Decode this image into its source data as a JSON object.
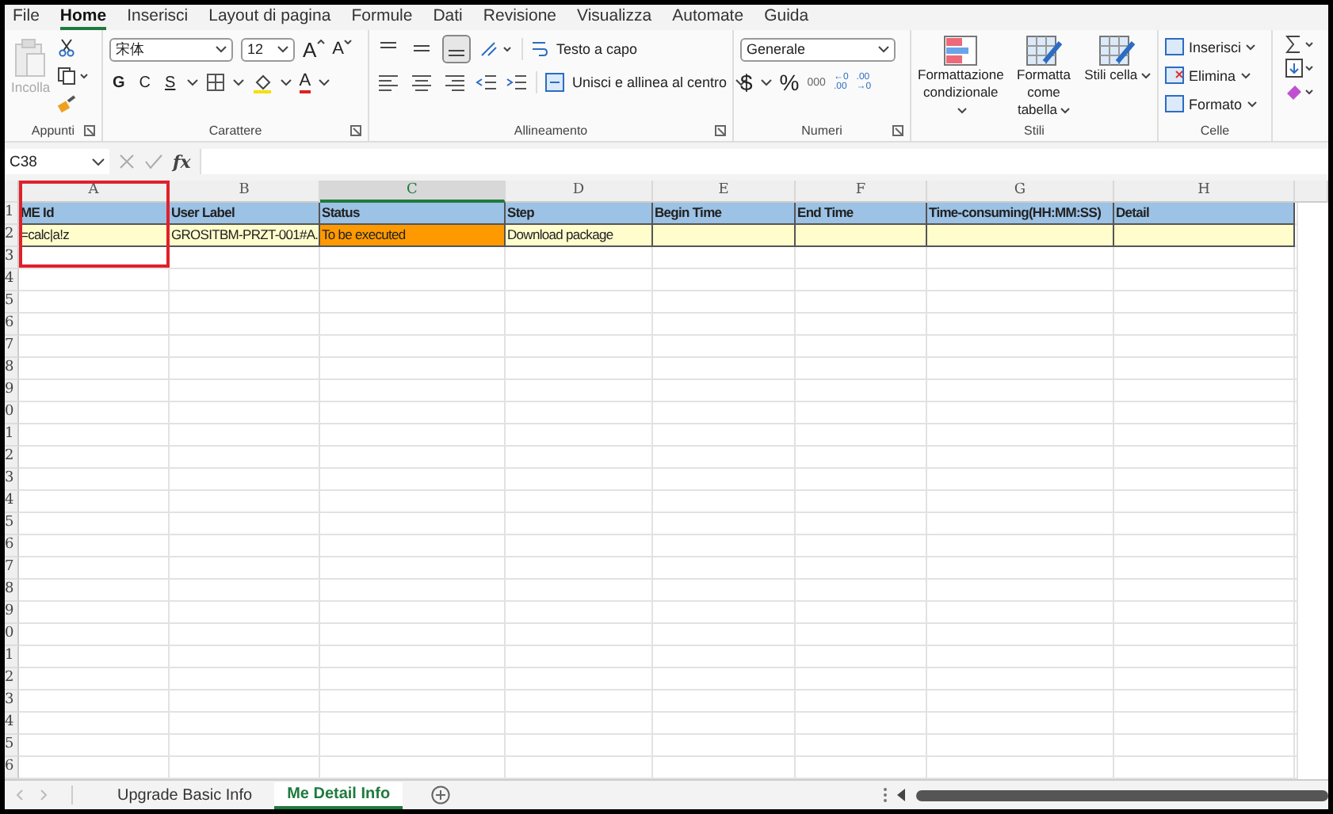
{
  "menu_tabs": [
    {
      "label": "File",
      "selected": false
    },
    {
      "label": "Home",
      "selected": true
    },
    {
      "label": "Inserisci",
      "selected": false
    },
    {
      "label": "Layout di pagina",
      "selected": false
    },
    {
      "label": "Formule",
      "selected": false
    },
    {
      "label": "Dati",
      "selected": false
    },
    {
      "label": "Revisione",
      "selected": false
    },
    {
      "label": "Visualizza",
      "selected": false
    },
    {
      "label": "Automate",
      "selected": false
    },
    {
      "label": "Guida",
      "selected": false
    }
  ],
  "ribbon": {
    "appunti": {
      "title": "Appunti",
      "paste": {
        "label": "Incolla",
        "disabled": true
      }
    },
    "carattere": {
      "title": "Carattere",
      "font": "宋体",
      "size": "12",
      "grow": "A",
      "shrink": "A",
      "bold": "G",
      "italic": "C",
      "underline": "S",
      "font_color": "A"
    },
    "allineamento": {
      "title": "Allineamento",
      "wrap": "Testo a capo",
      "merge": "Unisci e allinea al centro"
    },
    "numeri": {
      "title": "Numeri",
      "format": "Generale",
      "currency": "$",
      "percent": "%",
      "thousands": "000",
      "increase": "←0\n.00",
      "decrease": ".00\n→0"
    },
    "stili": {
      "title": "Stili",
      "buttons": [
        "Formattazione condizionale",
        "Formatta come tabella",
        "Stili cella"
      ]
    },
    "celle": {
      "title": "Celle",
      "buttons": [
        "Inserisci",
        "Elimina",
        "Formato"
      ]
    }
  },
  "formula_bar": {
    "name_box": "C38",
    "function_symbol": "fx"
  },
  "columns": [
    {
      "letter": "A",
      "selected": false
    },
    {
      "letter": "B",
      "selected": false
    },
    {
      "letter": "C",
      "selected": true
    },
    {
      "letter": "D",
      "selected": false
    },
    {
      "letter": "E",
      "selected": false
    },
    {
      "letter": "F",
      "selected": false
    },
    {
      "letter": "G",
      "selected": false
    },
    {
      "letter": "H",
      "selected": false
    }
  ],
  "rows": [
    {
      "number": "1",
      "kind": "header",
      "cells": [
        {
          "text": "ME Id",
          "highlight": false
        },
        {
          "text": "User Label",
          "highlight": false
        },
        {
          "text": "Status",
          "highlight": false
        },
        {
          "text": "Step",
          "highlight": false
        },
        {
          "text": "Begin Time",
          "highlight": false
        },
        {
          "text": "End Time",
          "highlight": false
        },
        {
          "text": "Time-consuming(HH:MM:SS)",
          "highlight": false
        },
        {
          "text": "Detail",
          "highlight": false
        }
      ]
    },
    {
      "number": "2",
      "kind": "data",
      "cells": [
        {
          "text": "=calc|a!z",
          "highlight": false
        },
        {
          "text": "GROSITBM-PRZT-001#A.",
          "highlight": false
        },
        {
          "text": "To be executed",
          "highlight": true
        },
        {
          "text": "Download package",
          "highlight": false
        },
        {
          "text": "",
          "highlight": false
        },
        {
          "text": "",
          "highlight": false
        },
        {
          "text": "",
          "highlight": false
        },
        {
          "text": "",
          "highlight": false
        }
      ]
    },
    {
      "number": "3",
      "kind": "blank"
    },
    {
      "number": "4",
      "kind": "blank"
    },
    {
      "number": "5",
      "kind": "blank"
    },
    {
      "number": "6",
      "kind": "blank"
    },
    {
      "number": "7",
      "kind": "blank"
    },
    {
      "number": "8",
      "kind": "blank"
    },
    {
      "number": "9",
      "kind": "blank"
    },
    {
      "number": "0",
      "kind": "blank"
    },
    {
      "number": "1",
      "kind": "blank"
    },
    {
      "number": "2",
      "kind": "blank"
    },
    {
      "number": "3",
      "kind": "blank"
    },
    {
      "number": "4",
      "kind": "blank"
    },
    {
      "number": "5",
      "kind": "blank"
    },
    {
      "number": "6",
      "kind": "blank"
    },
    {
      "number": "7",
      "kind": "blank"
    },
    {
      "number": "8",
      "kind": "blank"
    },
    {
      "number": "9",
      "kind": "blank"
    },
    {
      "number": "0",
      "kind": "blank"
    },
    {
      "number": "1",
      "kind": "blank"
    },
    {
      "number": "2",
      "kind": "blank"
    },
    {
      "number": "3",
      "kind": "blank"
    },
    {
      "number": "4",
      "kind": "blank"
    },
    {
      "number": "5",
      "kind": "blank"
    },
    {
      "number": "6",
      "kind": "blank"
    }
  ],
  "sheet_tabs": [
    {
      "label": "Upgrade Basic Info",
      "selected": false
    },
    {
      "label": "Me Detail Info",
      "selected": true
    }
  ]
}
